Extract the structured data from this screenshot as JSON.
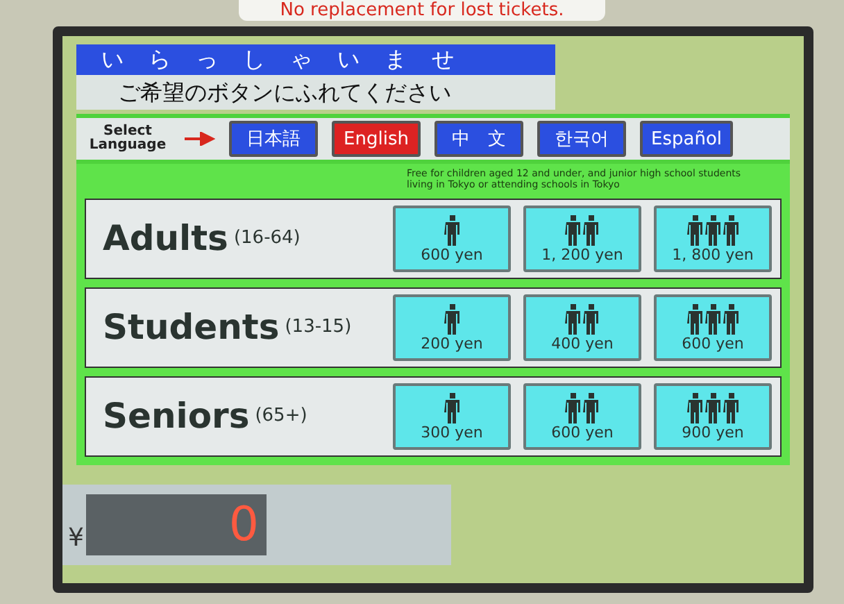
{
  "sticker": {
    "text": "No replacement for lost tickets."
  },
  "greeting": "いらっしゃいませ",
  "instruction": "ご希望のボタンにふれてください",
  "language_prompt": "Select Language",
  "languages": [
    {
      "label": "日本語",
      "selected": false
    },
    {
      "label": "English",
      "selected": true
    },
    {
      "label": "中　文",
      "selected": false
    },
    {
      "label": "한국어",
      "selected": false
    },
    {
      "label": "Español",
      "selected": false
    }
  ],
  "notice": "Free for children aged 12 and under, and junior high school students living in Tokyo or attending schools in Tokyo",
  "fares": [
    {
      "category": "Adults",
      "ages": "(16-64)",
      "options": [
        {
          "kind": "single",
          "price": "600 yen"
        },
        {
          "kind": "double",
          "price": "1, 200 yen"
        },
        {
          "kind": "triple",
          "price": "1, 800 yen"
        }
      ]
    },
    {
      "category": "Students",
      "ages": "(13-15)",
      "options": [
        {
          "kind": "single",
          "price": "200 yen"
        },
        {
          "kind": "double",
          "price": "400 yen"
        },
        {
          "kind": "triple",
          "price": "600 yen"
        }
      ]
    },
    {
      "category": "Seniors",
      "ages": "(65+)",
      "options": [
        {
          "kind": "single",
          "price": "300 yen"
        },
        {
          "kind": "double",
          "price": "600 yen"
        },
        {
          "kind": "triple",
          "price": "900 yen"
        }
      ]
    }
  ],
  "payment": {
    "currency": "¥",
    "amount": "0"
  }
}
